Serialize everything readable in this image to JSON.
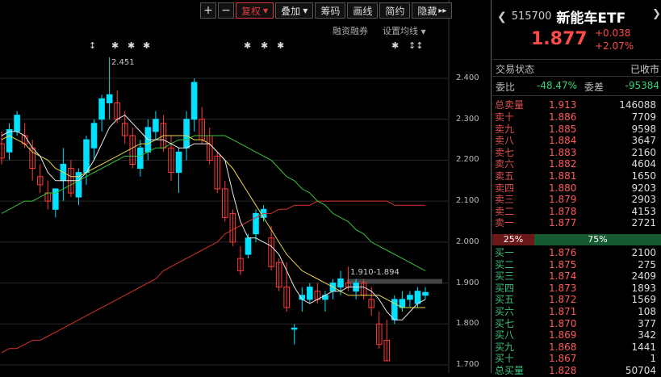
{
  "toolbar": {
    "zoom_in": "+",
    "zoom_out": "−",
    "restore_right": "复权",
    "overlay": "叠加",
    "chips": "筹码",
    "draw": "画线",
    "short_ver": "简约",
    "hide": "隐藏",
    "more": "▸▸"
  },
  "sublinks": {
    "margin": "融资融券",
    "ma_settings": "设置均线"
  },
  "events": [
    "↕",
    "✱",
    "✱",
    "✱",
    "✱",
    "✱",
    "✱",
    "✱",
    "✱",
    "↕↕"
  ],
  "chart_data": {
    "type": "candlestick",
    "ylim": [
      1.69,
      2.49
    ],
    "yticks": [
      "2.400",
      "2.300",
      "2.200",
      "2.100",
      "2.000",
      "1.900",
      "1.800",
      "1.700"
    ],
    "annotations": {
      "high_label": "2.451",
      "range_label": "1.910-1.894"
    },
    "colors": {
      "up": "#00e0ff",
      "down": "#ff3a3a",
      "ma5": "#e8e8e8",
      "ma10": "#e8d64a",
      "ma20": "#3ac23a",
      "ma60": "#d83030"
    },
    "candles": [
      {
        "o": 2.24,
        "h": 2.27,
        "l": 2.19,
        "c": 2.205
      },
      {
        "o": 2.22,
        "h": 2.29,
        "l": 2.2,
        "c": 2.275
      },
      {
        "o": 2.27,
        "h": 2.32,
        "l": 2.26,
        "c": 2.31
      },
      {
        "o": 2.26,
        "h": 2.29,
        "l": 2.23,
        "c": 2.24
      },
      {
        "o": 2.23,
        "h": 2.25,
        "l": 2.15,
        "c": 2.18
      },
      {
        "o": 2.16,
        "h": 2.19,
        "l": 2.12,
        "c": 2.14
      },
      {
        "o": 2.12,
        "h": 2.15,
        "l": 2.08,
        "c": 2.1
      },
      {
        "o": 2.08,
        "h": 2.13,
        "l": 2.06,
        "c": 2.13
      },
      {
        "o": 2.15,
        "h": 2.23,
        "l": 2.1,
        "c": 2.19
      },
      {
        "o": 2.18,
        "h": 2.2,
        "l": 2.11,
        "c": 2.12
      },
      {
        "o": 2.11,
        "h": 2.18,
        "l": 2.09,
        "c": 2.17
      },
      {
        "o": 2.17,
        "h": 2.26,
        "l": 2.14,
        "c": 2.25
      },
      {
        "o": 2.23,
        "h": 2.3,
        "l": 2.2,
        "c": 2.29
      },
      {
        "o": 2.3,
        "h": 2.36,
        "l": 2.27,
        "c": 2.35
      },
      {
        "o": 2.34,
        "h": 2.451,
        "l": 2.3,
        "c": 2.36
      },
      {
        "o": 2.34,
        "h": 2.37,
        "l": 2.29,
        "c": 2.3
      },
      {
        "o": 2.29,
        "h": 2.32,
        "l": 2.24,
        "c": 2.26
      },
      {
        "o": 2.26,
        "h": 2.28,
        "l": 2.18,
        "c": 2.19
      },
      {
        "o": 2.18,
        "h": 2.25,
        "l": 2.16,
        "c": 2.23
      },
      {
        "o": 2.22,
        "h": 2.3,
        "l": 2.2,
        "c": 2.28
      },
      {
        "o": 2.27,
        "h": 2.32,
        "l": 2.25,
        "c": 2.3
      },
      {
        "o": 2.29,
        "h": 2.31,
        "l": 2.22,
        "c": 2.23
      },
      {
        "o": 2.23,
        "h": 2.26,
        "l": 2.15,
        "c": 2.17
      },
      {
        "o": 2.17,
        "h": 2.23,
        "l": 2.12,
        "c": 2.22
      },
      {
        "o": 2.23,
        "h": 2.32,
        "l": 2.2,
        "c": 2.3
      },
      {
        "o": 2.3,
        "h": 2.4,
        "l": 2.27,
        "c": 2.39
      },
      {
        "o": 2.3,
        "h": 2.33,
        "l": 2.24,
        "c": 2.25
      },
      {
        "o": 2.26,
        "h": 2.28,
        "l": 2.19,
        "c": 2.2
      },
      {
        "o": 2.21,
        "h": 2.22,
        "l": 2.12,
        "c": 2.13
      },
      {
        "o": 2.13,
        "h": 2.15,
        "l": 2.05,
        "c": 2.06
      },
      {
        "o": 2.07,
        "h": 2.08,
        "l": 1.99,
        "c": 2.0
      },
      {
        "o": 1.96,
        "h": 1.99,
        "l": 1.92,
        "c": 1.93
      },
      {
        "o": 1.97,
        "h": 2.02,
        "l": 1.96,
        "c": 2.01
      },
      {
        "o": 2.02,
        "h": 2.08,
        "l": 2.0,
        "c": 2.07
      },
      {
        "o": 2.06,
        "h": 2.09,
        "l": 2.05,
        "c": 2.08
      },
      {
        "o": 2.01,
        "h": 2.04,
        "l": 1.93,
        "c": 1.94
      },
      {
        "o": 1.95,
        "h": 1.96,
        "l": 1.88,
        "c": 1.89
      },
      {
        "o": 1.89,
        "h": 1.95,
        "l": 1.83,
        "c": 1.84
      },
      {
        "o": 1.79,
        "h": 1.8,
        "l": 1.75,
        "c": 1.79
      },
      {
        "o": 1.86,
        "h": 1.89,
        "l": 1.83,
        "c": 1.87
      },
      {
        "o": 1.86,
        "h": 1.9,
        "l": 1.85,
        "c": 1.89
      },
      {
        "o": 1.88,
        "h": 1.9,
        "l": 1.85,
        "c": 1.86
      },
      {
        "o": 1.86,
        "h": 1.88,
        "l": 1.83,
        "c": 1.87
      },
      {
        "o": 1.88,
        "h": 1.91,
        "l": 1.86,
        "c": 1.9
      },
      {
        "o": 1.89,
        "h": 1.93,
        "l": 1.87,
        "c": 1.91
      },
      {
        "o": 1.9,
        "h": 1.94,
        "l": 1.88,
        "c": 1.89
      },
      {
        "o": 1.88,
        "h": 1.91,
        "l": 1.86,
        "c": 1.9
      },
      {
        "o": 1.9,
        "h": 1.91,
        "l": 1.86,
        "c": 1.87
      },
      {
        "o": 1.86,
        "h": 1.89,
        "l": 1.82,
        "c": 1.84
      },
      {
        "o": 1.8,
        "h": 1.83,
        "l": 1.74,
        "c": 1.75
      },
      {
        "o": 1.76,
        "h": 1.81,
        "l": 1.71,
        "c": 1.71
      },
      {
        "o": 1.81,
        "h": 1.87,
        "l": 1.8,
        "c": 1.86
      },
      {
        "o": 1.84,
        "h": 1.88,
        "l": 1.83,
        "c": 1.86
      },
      {
        "o": 1.86,
        "h": 1.88,
        "l": 1.84,
        "c": 1.87
      },
      {
        "o": 1.85,
        "h": 1.89,
        "l": 1.84,
        "c": 1.88
      },
      {
        "o": 1.87,
        "h": 1.89,
        "l": 1.86,
        "c": 1.877
      }
    ],
    "ma5": [
      2.26,
      2.27,
      2.27,
      2.26,
      2.23,
      2.21,
      2.17,
      2.15,
      2.15,
      2.15,
      2.15,
      2.17,
      2.2,
      2.24,
      2.28,
      2.3,
      2.31,
      2.29,
      2.27,
      2.25,
      2.25,
      2.25,
      2.24,
      2.23,
      2.23,
      2.24,
      2.24,
      2.24,
      2.22,
      2.2,
      2.12,
      2.05,
      2.01,
      2.01,
      2.0,
      1.99,
      1.97,
      1.93,
      1.89,
      1.86,
      1.85,
      1.86,
      1.87,
      1.88,
      1.88,
      1.89,
      1.89,
      1.89,
      1.88,
      1.86,
      1.83,
      1.81,
      1.81,
      1.83,
      1.85,
      1.86
    ],
    "ma10": [
      2.25,
      2.26,
      2.25,
      2.24,
      2.22,
      2.21,
      2.2,
      2.18,
      2.17,
      2.16,
      2.16,
      2.17,
      2.18,
      2.19,
      2.2,
      2.21,
      2.22,
      2.23,
      2.24,
      2.24,
      2.25,
      2.26,
      2.26,
      2.26,
      2.26,
      2.25,
      2.25,
      2.24,
      2.22,
      2.2,
      2.18,
      2.15,
      2.12,
      2.09,
      2.06,
      2.03,
      2.0,
      1.97,
      1.95,
      1.93,
      1.92,
      1.91,
      1.9,
      1.89,
      1.88,
      1.87,
      1.87,
      1.87,
      1.87,
      1.87,
      1.86,
      1.85,
      1.84,
      1.84,
      1.84,
      1.84
    ],
    "ma20": [
      2.07,
      2.08,
      2.09,
      2.1,
      2.1,
      2.11,
      2.12,
      2.12,
      2.13,
      2.14,
      2.15,
      2.16,
      2.17,
      2.18,
      2.19,
      2.2,
      2.21,
      2.21,
      2.21,
      2.22,
      2.23,
      2.23,
      2.24,
      2.25,
      2.25,
      2.26,
      2.26,
      2.26,
      2.26,
      2.26,
      2.25,
      2.24,
      2.23,
      2.22,
      2.21,
      2.2,
      2.18,
      2.16,
      2.15,
      2.13,
      2.12,
      2.1,
      2.09,
      2.07,
      2.06,
      2.05,
      2.03,
      2.02,
      2.0,
      1.99,
      1.98,
      1.97,
      1.96,
      1.95,
      1.94,
      1.93
    ],
    "ma60": [
      1.73,
      1.74,
      1.74,
      1.75,
      1.76,
      1.76,
      1.77,
      1.78,
      1.79,
      1.8,
      1.81,
      1.82,
      1.83,
      1.84,
      1.85,
      1.86,
      1.87,
      1.88,
      1.89,
      1.9,
      1.91,
      1.93,
      1.94,
      1.95,
      1.96,
      1.97,
      1.98,
      1.99,
      2.0,
      2.02,
      2.03,
      2.04,
      2.05,
      2.06,
      2.07,
      2.07,
      2.08,
      2.08,
      2.09,
      2.09,
      2.09,
      2.1,
      2.1,
      2.1,
      2.1,
      2.1,
      2.1,
      2.1,
      2.1,
      2.1,
      2.1,
      2.09,
      2.09,
      2.09,
      2.09,
      2.09
    ]
  },
  "panel": {
    "code": "515700",
    "name": "新能车ETF",
    "price": "1.877",
    "change": "+0.038",
    "change_pct": "+2.07%",
    "trade_status_label": "交易状态",
    "trade_status_value": "已收市",
    "wei_bi_label": "委比",
    "wei_bi_value": "-48.47%",
    "wei_cha_label": "委差",
    "wei_cha_value": "-95384",
    "total_sell": {
      "name": "总卖量",
      "price": "1.913",
      "vol": "146088"
    },
    "asks": [
      {
        "name": "卖十",
        "price": "1.886",
        "vol": "7709"
      },
      {
        "name": "卖九",
        "price": "1.885",
        "vol": "9598"
      },
      {
        "name": "卖八",
        "price": "1.884",
        "vol": "3647"
      },
      {
        "name": "卖七",
        "price": "1.883",
        "vol": "2160"
      },
      {
        "name": "卖六",
        "price": "1.882",
        "vol": "4604"
      },
      {
        "name": "卖五",
        "price": "1.881",
        "vol": "1650"
      },
      {
        "name": "卖四",
        "price": "1.880",
        "vol": "9203"
      },
      {
        "name": "卖三",
        "price": "1.879",
        "vol": "2903"
      },
      {
        "name": "卖二",
        "price": "1.878",
        "vol": "4153"
      },
      {
        "name": "卖一",
        "price": "1.877",
        "vol": "2721"
      }
    ],
    "ratio_sell": "25%",
    "ratio_buy": "75%",
    "bids": [
      {
        "name": "买一",
        "price": "1.876",
        "vol": "2100"
      },
      {
        "name": "买二",
        "price": "1.875",
        "vol": "275"
      },
      {
        "name": "买三",
        "price": "1.874",
        "vol": "2409"
      },
      {
        "name": "买四",
        "price": "1.873",
        "vol": "1893"
      },
      {
        "name": "买五",
        "price": "1.872",
        "vol": "1569"
      },
      {
        "name": "买六",
        "price": "1.871",
        "vol": "108"
      },
      {
        "name": "买七",
        "price": "1.870",
        "vol": "377"
      },
      {
        "name": "买八",
        "price": "1.869",
        "vol": "342"
      },
      {
        "name": "买九",
        "price": "1.868",
        "vol": "1441"
      },
      {
        "name": "买十",
        "price": "1.867",
        "vol": "1"
      }
    ],
    "total_buy": {
      "name": "总买量",
      "price": "1.828",
      "vol": "50704"
    }
  }
}
